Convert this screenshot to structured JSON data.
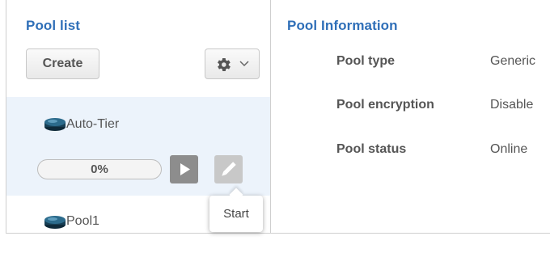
{
  "pool_list": {
    "title": "Pool list",
    "create_label": "Create",
    "settings_icon": "gear-icon",
    "dropdown_icon": "chevron-down-icon",
    "pools": [
      {
        "name": "Auto-Tier",
        "icon": "disk-icon",
        "progress_label": "0%",
        "progress_value": 0
      },
      {
        "name": "Pool1",
        "icon": "disk-icon"
      }
    ],
    "start_tooltip": "Start"
  },
  "pool_info": {
    "title": "Pool Information",
    "rows": [
      {
        "label": "Pool type",
        "value": "Generic"
      },
      {
        "label": "Pool encryption",
        "value": "Disable"
      },
      {
        "label": "Pool status",
        "value": "Online"
      }
    ]
  },
  "colors": {
    "accent": "#2f6fb8",
    "selected_row": "#ecf3fb"
  }
}
